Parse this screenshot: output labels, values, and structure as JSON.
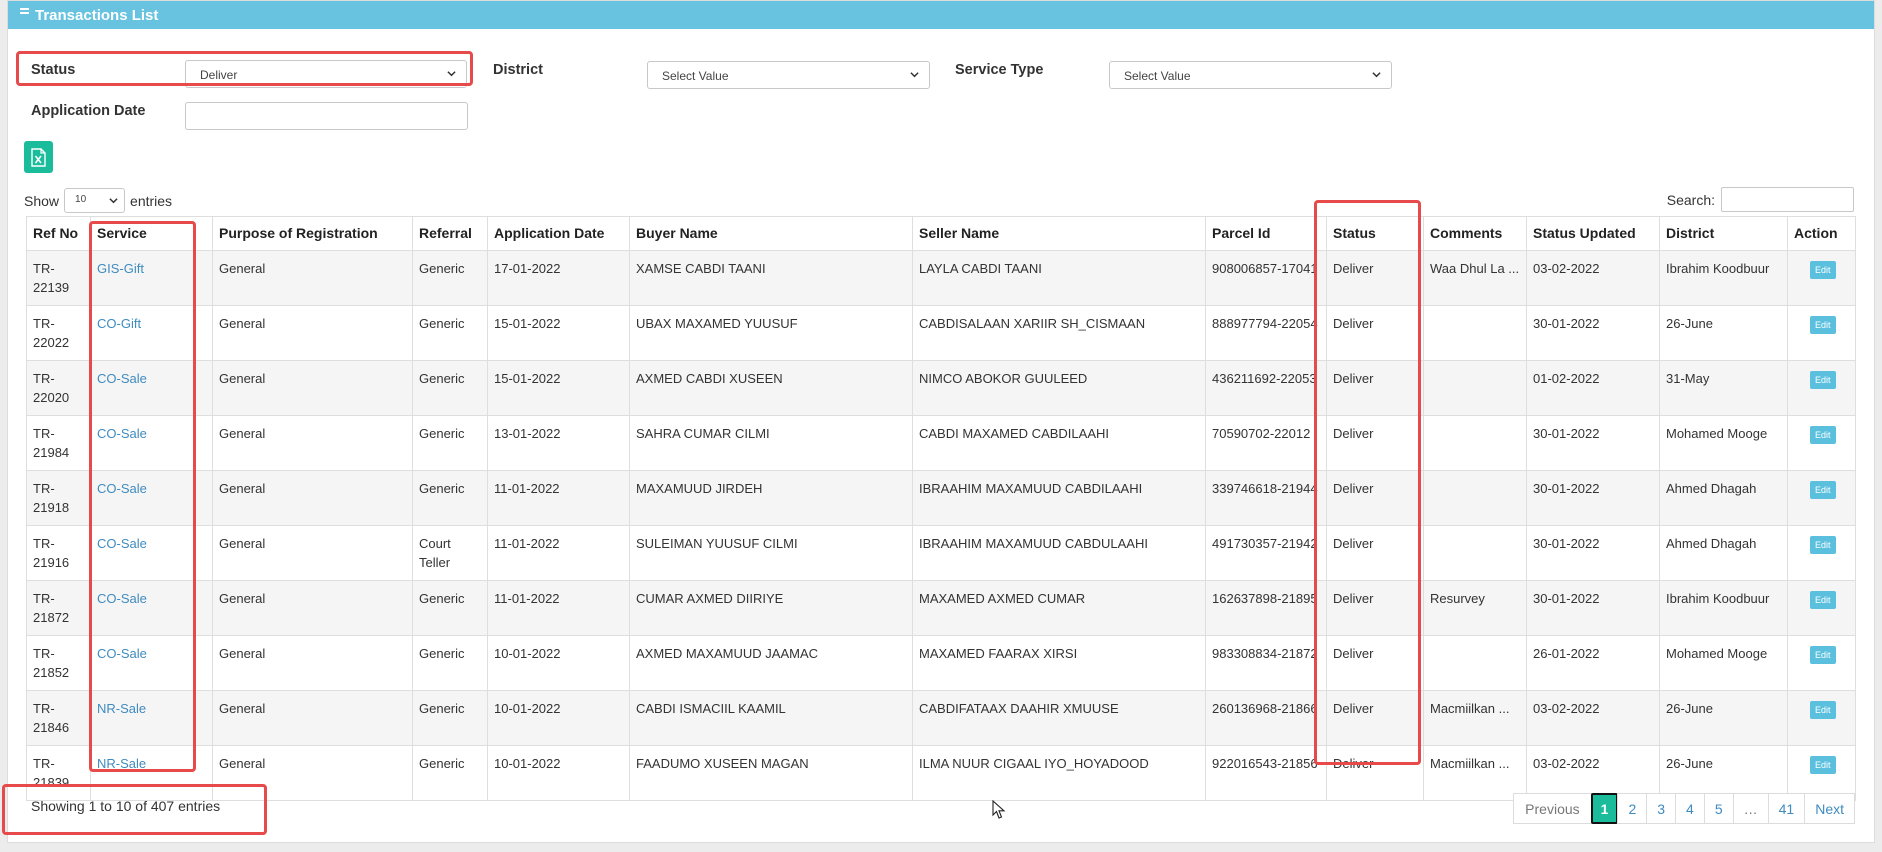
{
  "header": {
    "title": "Transactions List"
  },
  "filters": {
    "status_label": "Status",
    "status_value": "Deliver",
    "district_label": "District",
    "district_value": "Select Value",
    "service_type_label": "Service Type",
    "service_type_value": "Select Value",
    "application_date_label": "Application Date",
    "application_date_value": ""
  },
  "excel_icon": "excel-icon",
  "length": {
    "show_label": "Show",
    "value": "10",
    "entries_label": "entries"
  },
  "search": {
    "label": "Search:",
    "value": ""
  },
  "table": {
    "columns": [
      "Ref No",
      "Service",
      "Purpose of Registration",
      "Referral",
      "Application Date",
      "Buyer Name",
      "Seller Name",
      "Parcel Id",
      "Status",
      "Comments",
      "Status Updated",
      "District",
      "Action"
    ],
    "rows": [
      [
        "TR-22139",
        "GIS-Gift",
        "General",
        "Generic",
        "17-01-2022",
        "XAMSE CABDI TAANI",
        "LAYLA CABDI TAANI",
        "908006857-17041",
        "Deliver",
        "Waa Dhul La ...",
        "03-02-2022",
        "Ibrahim Koodbuur",
        "Edit"
      ],
      [
        "TR-22022",
        "CO-Gift",
        "General",
        "Generic",
        "15-01-2022",
        "UBAX MAXAMED YUUSUF",
        "CABDISALAAN XARIIR SH_CISMAAN",
        "888977794-22054",
        "Deliver",
        "",
        "30-01-2022",
        "26-June",
        "Edit"
      ],
      [
        "TR-22020",
        "CO-Sale",
        "General",
        "Generic",
        "15-01-2022",
        "AXMED CABDI XUSEEN",
        "NIMCO ABOKOR GUULEED",
        "436211692-22053",
        "Deliver",
        "",
        "01-02-2022",
        "31-May",
        "Edit"
      ],
      [
        "TR-21984",
        "CO-Sale",
        "General",
        "Generic",
        "13-01-2022",
        "SAHRA CUMAR CILMI",
        "CABDI MAXAMED CABDILAAHI",
        "70590702-22012",
        "Deliver",
        "",
        "30-01-2022",
        "Mohamed Mooge",
        "Edit"
      ],
      [
        "TR-21918",
        "CO-Sale",
        "General",
        "Generic",
        "11-01-2022",
        "MAXAMUUD JIRDEH",
        "IBRAAHIM MAXAMUUD CABDILAAHI",
        "339746618-21944",
        "Deliver",
        "",
        "30-01-2022",
        "Ahmed Dhagah",
        "Edit"
      ],
      [
        "TR-21916",
        "CO-Sale",
        "General",
        "Court Teller",
        "11-01-2022",
        "SULEIMAN YUUSUF CILMI",
        "IBRAAHIM MAXAMUUD CABDULAAHI",
        "491730357-21942",
        "Deliver",
        "",
        "30-01-2022",
        "Ahmed Dhagah",
        "Edit"
      ],
      [
        "TR-21872",
        "CO-Sale",
        "General",
        "Generic",
        "11-01-2022",
        "CUMAR AXMED DIIRIYE",
        "MAXAMED AXMED CUMAR",
        "162637898-21895",
        "Deliver",
        "Resurvey",
        "30-01-2022",
        "Ibrahim Koodbuur",
        "Edit"
      ],
      [
        "TR-21852",
        "CO-Sale",
        "General",
        "Generic",
        "10-01-2022",
        "AXMED MAXAMUUD JAAMAC",
        "MAXAMED FAARAX XIRSI",
        "983308834-21872",
        "Deliver",
        "",
        "26-01-2022",
        "Mohamed Mooge",
        "Edit"
      ],
      [
        "TR-21846",
        "NR-Sale",
        "General",
        "Generic",
        "10-01-2022",
        "CABDI ISMACIIL KAAMIL",
        "CABDIFATAAX DAAHIR XMUUSE",
        "260136968-21866",
        "Deliver",
        "Macmiilkan ...",
        "03-02-2022",
        "26-June",
        "Edit"
      ],
      [
        "TR-21839",
        "NR-Sale",
        "General",
        "Generic",
        "10-01-2022",
        "FAADUMO XUSEEN MAGAN",
        "ILMA NUUR CIGAAL IYO_HOYADOOD",
        "922016543-21856",
        "Deliver",
        "Macmiilkan ...",
        "03-02-2022",
        "26-June",
        "Edit"
      ]
    ]
  },
  "info": "Showing 1 to 10 of 407 entries",
  "pagination": {
    "previous": "Previous",
    "pages": [
      "1",
      "2",
      "3",
      "4",
      "5",
      "…",
      "41"
    ],
    "next": "Next",
    "active": "1"
  },
  "colors": {
    "header": "#67c3e0",
    "accent": "#1abc9c",
    "link": "#3f8bbf",
    "edit": "#5bc0de",
    "highlight": "#e64a4a"
  }
}
